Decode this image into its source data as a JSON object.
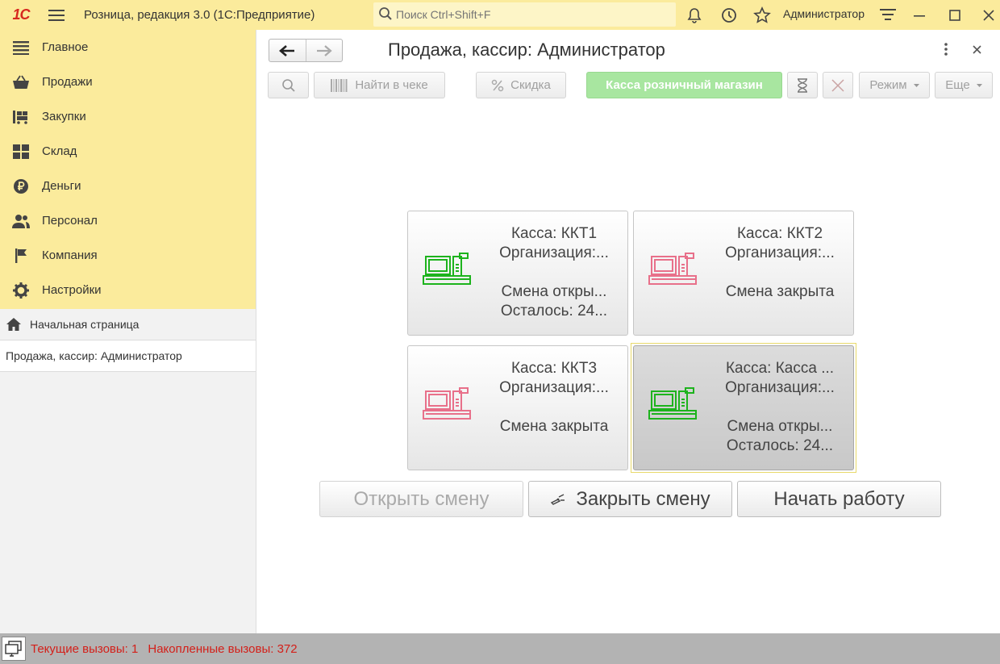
{
  "app": {
    "logo_text": "1С",
    "title": "Розница, редакция 3.0  (1С:Предприятие)",
    "search_placeholder": "Поиск Ctrl+Shift+F",
    "user": "Администратор"
  },
  "sidebar": {
    "sections": [
      {
        "label": "Главное",
        "icon": "list-icon"
      },
      {
        "label": "Продажи",
        "icon": "basket-icon"
      },
      {
        "label": "Закупки",
        "icon": "cart-icon"
      },
      {
        "label": "Склад",
        "icon": "grid-icon"
      },
      {
        "label": "Деньги",
        "icon": "ruble-icon"
      },
      {
        "label": "Персонал",
        "icon": "people-icon"
      },
      {
        "label": "Компания",
        "icon": "flag-icon"
      },
      {
        "label": "Настройки",
        "icon": "gear-icon"
      }
    ],
    "home_label": "Начальная страница",
    "open_form_label": "Продажа, кассир: Администратор"
  },
  "form": {
    "title": "Продажа, кассир: Администратор",
    "toolbar": {
      "find_in_receipt": "Найти в чеке",
      "discount": "Скидка",
      "cash_register": "Касса розничный магазин",
      "mode": "Режим",
      "more": "Еще"
    },
    "tiles": [
      {
        "line1": "Касса: ККТ1",
        "line2": "Организация:...",
        "line3": "Смена откры...",
        "line4": "Осталось: 24...",
        "status": "open"
      },
      {
        "line1": "Касса: ККТ2",
        "line2": "Организация:...",
        "line3": "Смена закрыта",
        "line4": "",
        "status": "closed"
      },
      {
        "line1": "Касса: ККТ3",
        "line2": "Организация:...",
        "line3": "Смена закрыта",
        "line4": "",
        "status": "closed"
      },
      {
        "line1": "Касса: Касса ...",
        "line2": "Организация:...",
        "line3": "Смена откры...",
        "line4": "Осталось: 24...",
        "status": "open"
      }
    ],
    "buttons": {
      "open_shift": "Открыть смену",
      "close_shift": "Закрыть смену",
      "start_work": "Начать работу"
    }
  },
  "status_bar": {
    "current_calls": "Текущие вызовы: 1",
    "accumulated_calls": "Накопленные вызовы: 372"
  },
  "colors": {
    "accent_yellow": "#fbeb9c",
    "open_register": "#1db31d",
    "closed_register": "#e8708a",
    "status_text": "#d3201a"
  }
}
